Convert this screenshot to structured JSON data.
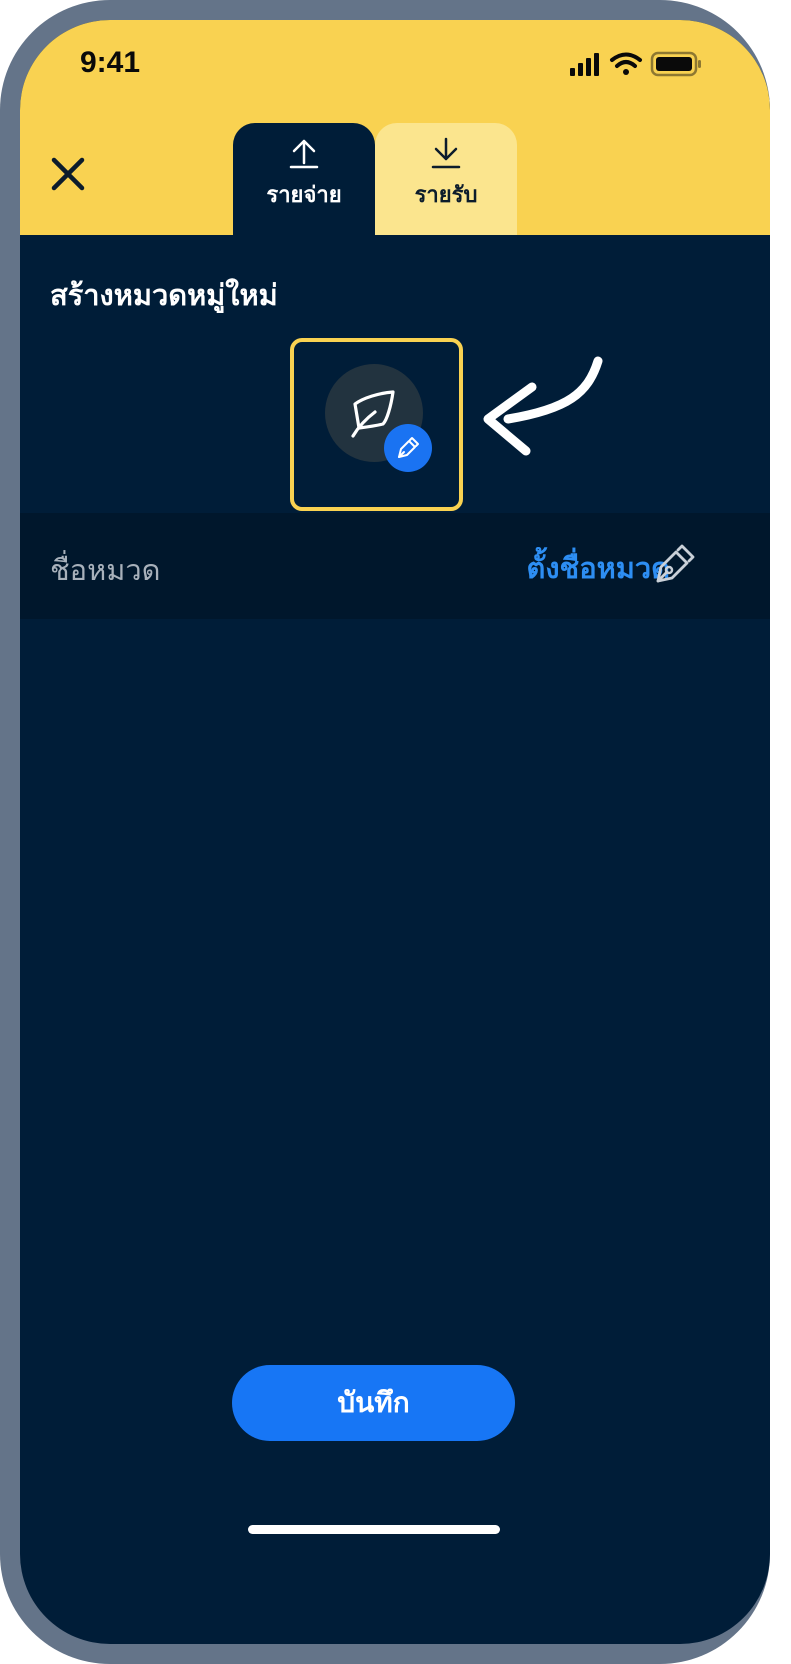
{
  "status_bar": {
    "time": "9:41",
    "icons": [
      "cellular-signal-icon",
      "wifi-icon",
      "battery-icon"
    ]
  },
  "header": {
    "close_icon": "close-icon",
    "tabs": [
      {
        "label": "รายจ่าย",
        "icon": "upload-icon",
        "selected": true
      },
      {
        "label": "รายรับ",
        "icon": "download-icon",
        "selected": false
      }
    ]
  },
  "main": {
    "title": "สร้างหมวดหมู่ใหม่",
    "category_icon": "feather-icon",
    "edit_badge_icon": "pen-icon",
    "name_row": {
      "label": "ชื่อหมวด",
      "value": "ตั้งชื่อหมวด",
      "edit_icon": "pen-icon"
    }
  },
  "footer": {
    "save_label": "บันทึก"
  },
  "colors": {
    "header_bg": "#f9d251",
    "screen_bg": "#001d38",
    "accent_blue": "#1776f5",
    "link_blue": "#2d8ef3",
    "highlight_yellow": "#f9d251",
    "device_frame": "#647489"
  }
}
